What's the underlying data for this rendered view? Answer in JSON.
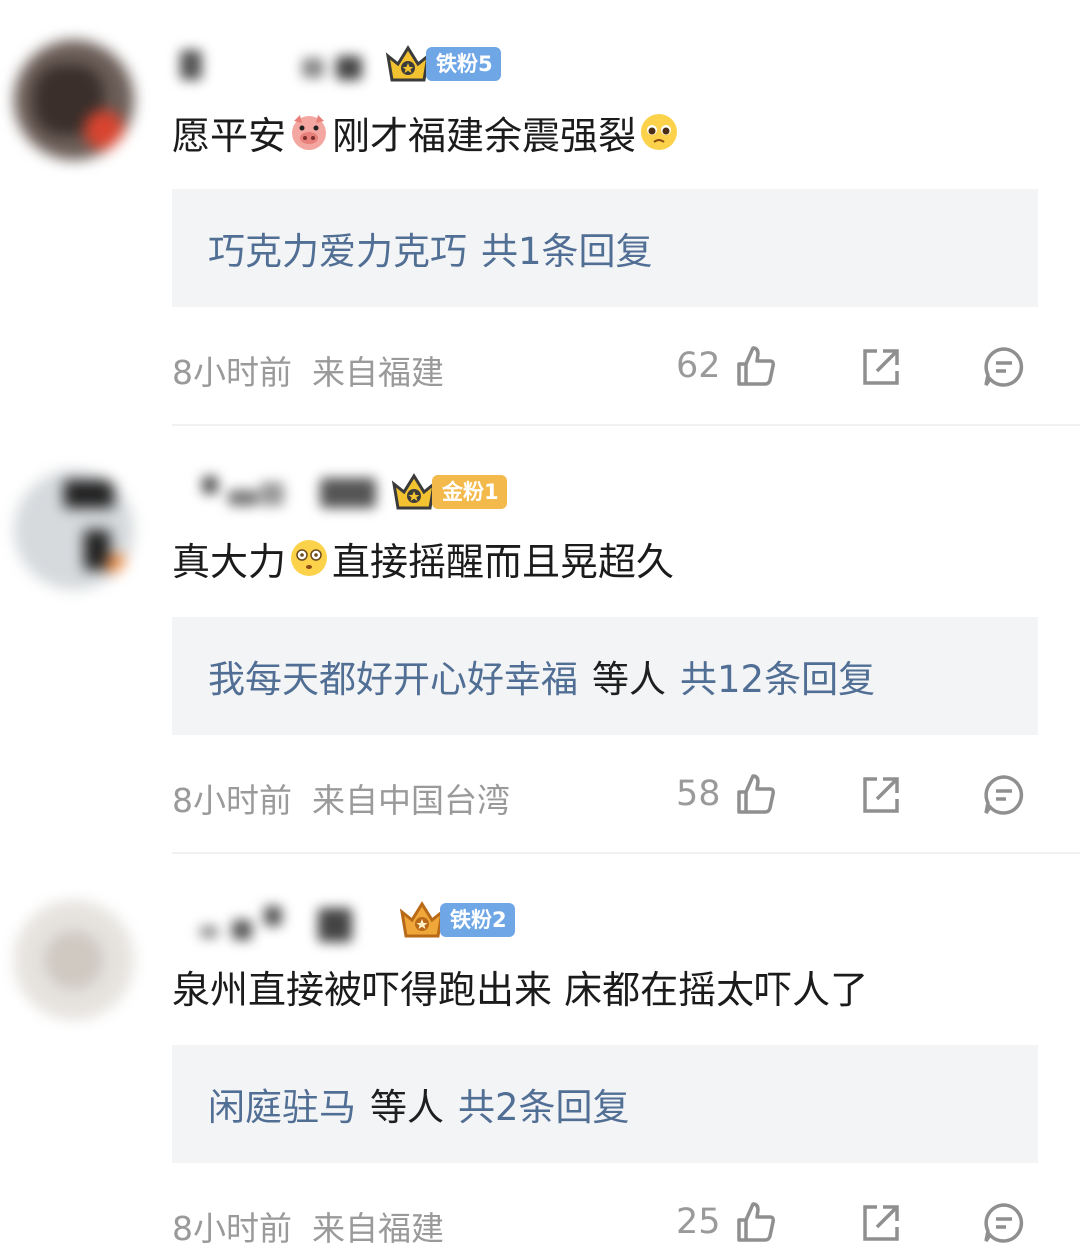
{
  "comments": [
    {
      "badge": "铁粉5",
      "badge_color": "#6ea6e6",
      "crown_color": "#f2c230",
      "text_before": "愿平安",
      "text_middle": "刚才福建余震强裂",
      "emoji1": "pig-face-emoji",
      "emoji2": "pleading-face-emoji",
      "reply_names": "巧克力爱力克巧",
      "reply_others": "",
      "reply_count": "共1条回复",
      "time": "8小时前",
      "location": "来自福建",
      "likes": "62"
    },
    {
      "badge": "金粉1",
      "badge_color": "#f3b94a",
      "crown_color": "#f2c230",
      "text_before": "真大力",
      "text_middle": "直接摇醒而且晃超久",
      "emoji1": "dizzy-face-emoji",
      "reply_names": "我每天都好开心好幸福",
      "reply_others": "等人",
      "reply_count": "共12条回复",
      "time": "8小时前",
      "location": "来自中国台湾",
      "likes": "58"
    },
    {
      "badge": "铁粉2",
      "badge_color": "#6ea6e6",
      "crown_color": "#f0a73a",
      "text_before": "泉州直接被吓得跑出来 床都在摇太吓人了",
      "reply_names": "闲庭驻马",
      "reply_others": "等人",
      "reply_count": "共2条回复",
      "time": "8小时前",
      "location": "来自福建",
      "likes": "25"
    }
  ],
  "icons": {
    "like": "thumbs-up-icon",
    "share": "share-icon",
    "comment": "comment-icon"
  }
}
